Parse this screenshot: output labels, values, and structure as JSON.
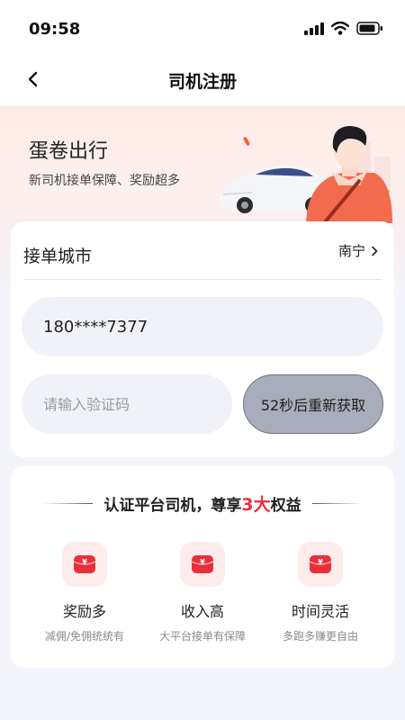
{
  "status_bar": {
    "time": "09:58"
  },
  "nav": {
    "title": "司机注册"
  },
  "banner": {
    "title": "蛋卷出行",
    "subtitle": "新司机接单保障、奖励超多"
  },
  "form": {
    "city_label": "接单城市",
    "city_value": "南宁",
    "phone_value": "180****7377",
    "code_placeholder": "请输入验证码",
    "resend_label": "52秒后重新获取"
  },
  "benefits": {
    "heading_before": "认证平台司机，尊享",
    "heading_highlight": "3大",
    "heading_after": "权益",
    "items": [
      {
        "title": "奖励多",
        "subtitle": "减佣/免佣统统有",
        "icon": "red-envelope-yuan-icon"
      },
      {
        "title": "收入高",
        "subtitle": "大平台接单有保障",
        "icon": "red-envelope-yuan-icon"
      },
      {
        "title": "时间灵活",
        "subtitle": "多跑多赚更自由",
        "icon": "red-envelope-yuan-icon"
      }
    ]
  },
  "colors": {
    "accent": "#e8303b",
    "input_bg": "#f1f2f7",
    "button_disabled": "#a9acbb"
  }
}
